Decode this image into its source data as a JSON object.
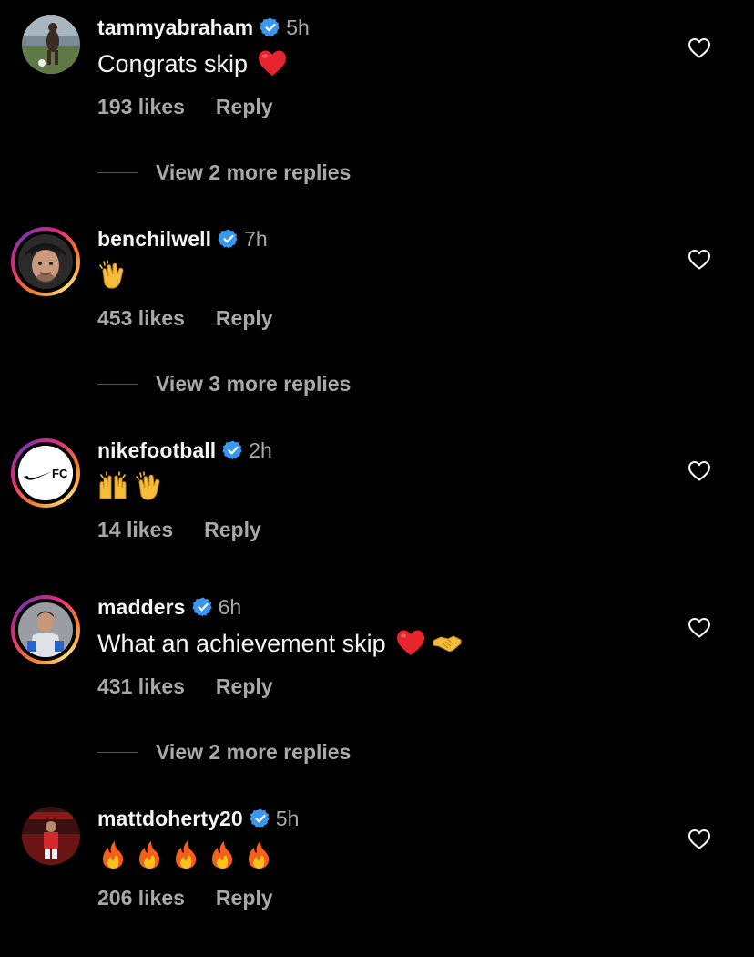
{
  "comments": [
    {
      "username": "tammyabraham",
      "verified": true,
      "time": "5h",
      "text": "Congrats skip",
      "emojis": [
        "red-heart-emoji"
      ],
      "likes": "193 likes",
      "reply": "Reply",
      "view_replies": "View 2 more replies",
      "avatar_ring": false
    },
    {
      "username": "benchilwell",
      "verified": true,
      "time": "7h",
      "text": "",
      "emojis": [
        "clapping-hands-emoji"
      ],
      "likes": "453 likes",
      "reply": "Reply",
      "view_replies": "View 3 more replies",
      "avatar_ring": true
    },
    {
      "username": "nikefootball",
      "verified": true,
      "time": "2h",
      "text": "",
      "emojis": [
        "raising-hands-emoji",
        "clapping-hands-emoji"
      ],
      "likes": "14 likes",
      "reply": "Reply",
      "view_replies": "",
      "avatar_ring": true,
      "avatar_text": "FC"
    },
    {
      "username": "madders",
      "verified": true,
      "time": "6h",
      "text": "What an achievement skip",
      "emojis": [
        "red-heart-emoji",
        "handshake-emoji"
      ],
      "likes": "431 likes",
      "reply": "Reply",
      "view_replies": "View 2 more replies",
      "avatar_ring": true
    },
    {
      "username": "mattdoherty20",
      "verified": true,
      "time": "5h",
      "text": "",
      "emojis": [
        "fire-emoji",
        "fire-emoji",
        "fire-emoji",
        "fire-emoji",
        "fire-emoji"
      ],
      "likes": "206 likes",
      "reply": "Reply",
      "view_replies": "",
      "avatar_ring": false
    }
  ],
  "colors": {
    "background": "#000000",
    "primary_text": "#f5f5f5",
    "secondary_text": "#a8a8a8",
    "verified_badge": "#3897f0",
    "heart_outline": "#f5f5f5"
  }
}
